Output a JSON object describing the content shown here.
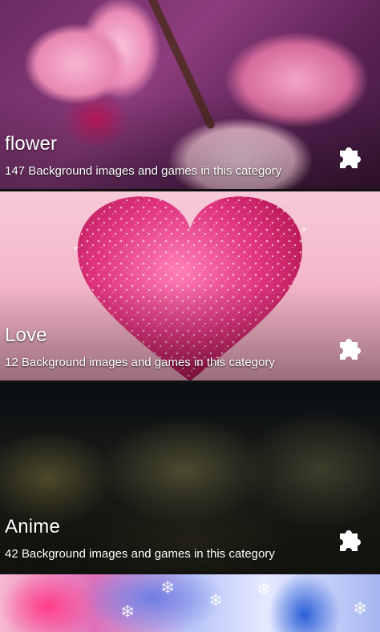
{
  "categories": [
    {
      "title": "flower",
      "subtitle": "147 Background images and games in this category",
      "icon": "puzzle-icon"
    },
    {
      "title": "Love",
      "subtitle": "12 Background images and games in this category",
      "icon": "puzzle-icon"
    },
    {
      "title": "Anime",
      "subtitle": "42 Background images and games in this category",
      "icon": "puzzle-icon"
    }
  ],
  "colors": {
    "text": "#ffffff",
    "flower_bg": "#8d3d7d",
    "love_bg": "#f4b6c9",
    "heart": "#d81b60",
    "anime_bg": "#1a1b14"
  }
}
